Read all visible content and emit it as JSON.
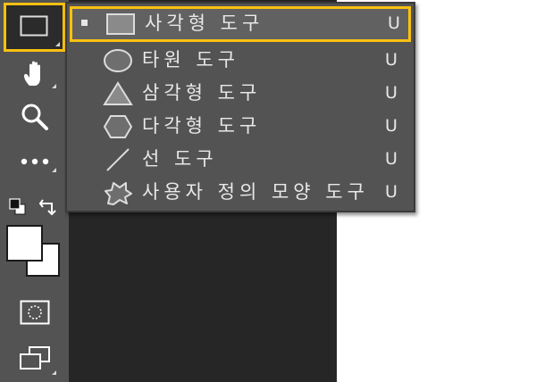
{
  "toolbar": {
    "tools": [
      {
        "name": "rectangle-tool",
        "icon": "rectangle-icon",
        "active": true
      },
      {
        "name": "hand-tool",
        "icon": "hand-icon"
      },
      {
        "name": "zoom-tool",
        "icon": "magnifier-icon"
      },
      {
        "name": "more-tools",
        "icon": "ellipsis-icon"
      },
      {
        "name": "default-colors",
        "icon": "default-colors-icon"
      },
      {
        "name": "swap-colors",
        "icon": "swap-arrow-icon"
      },
      {
        "name": "color-swatches",
        "icon": "fg-bg-swatch-icon",
        "foreground": "#ffffff",
        "background": "#ffffff"
      },
      {
        "name": "quick-mask",
        "icon": "quick-mask-icon"
      },
      {
        "name": "screen-mode",
        "icon": "screen-mode-icon"
      }
    ]
  },
  "flyout": {
    "items": [
      {
        "label": "사각형 도구",
        "shortcut": "U",
        "icon": "rectangle-icon",
        "selected": true
      },
      {
        "label": "타원 도구",
        "shortcut": "U",
        "icon": "ellipse-icon",
        "selected": false
      },
      {
        "label": "삼각형 도구",
        "shortcut": "U",
        "icon": "triangle-icon",
        "selected": false
      },
      {
        "label": "다각형 도구",
        "shortcut": "U",
        "icon": "hexagon-icon",
        "selected": false
      },
      {
        "label": "선 도구",
        "shortcut": "U",
        "icon": "line-icon",
        "selected": false
      },
      {
        "label": "사용자 정의 모양 도구",
        "shortcut": "U",
        "icon": "custom-shape-icon",
        "selected": false
      }
    ]
  },
  "colors": {
    "highlight": "#f9c011",
    "toolbar_bg": "#535353",
    "canvas_bg": "#262626",
    "text": "#e8e8e8"
  }
}
